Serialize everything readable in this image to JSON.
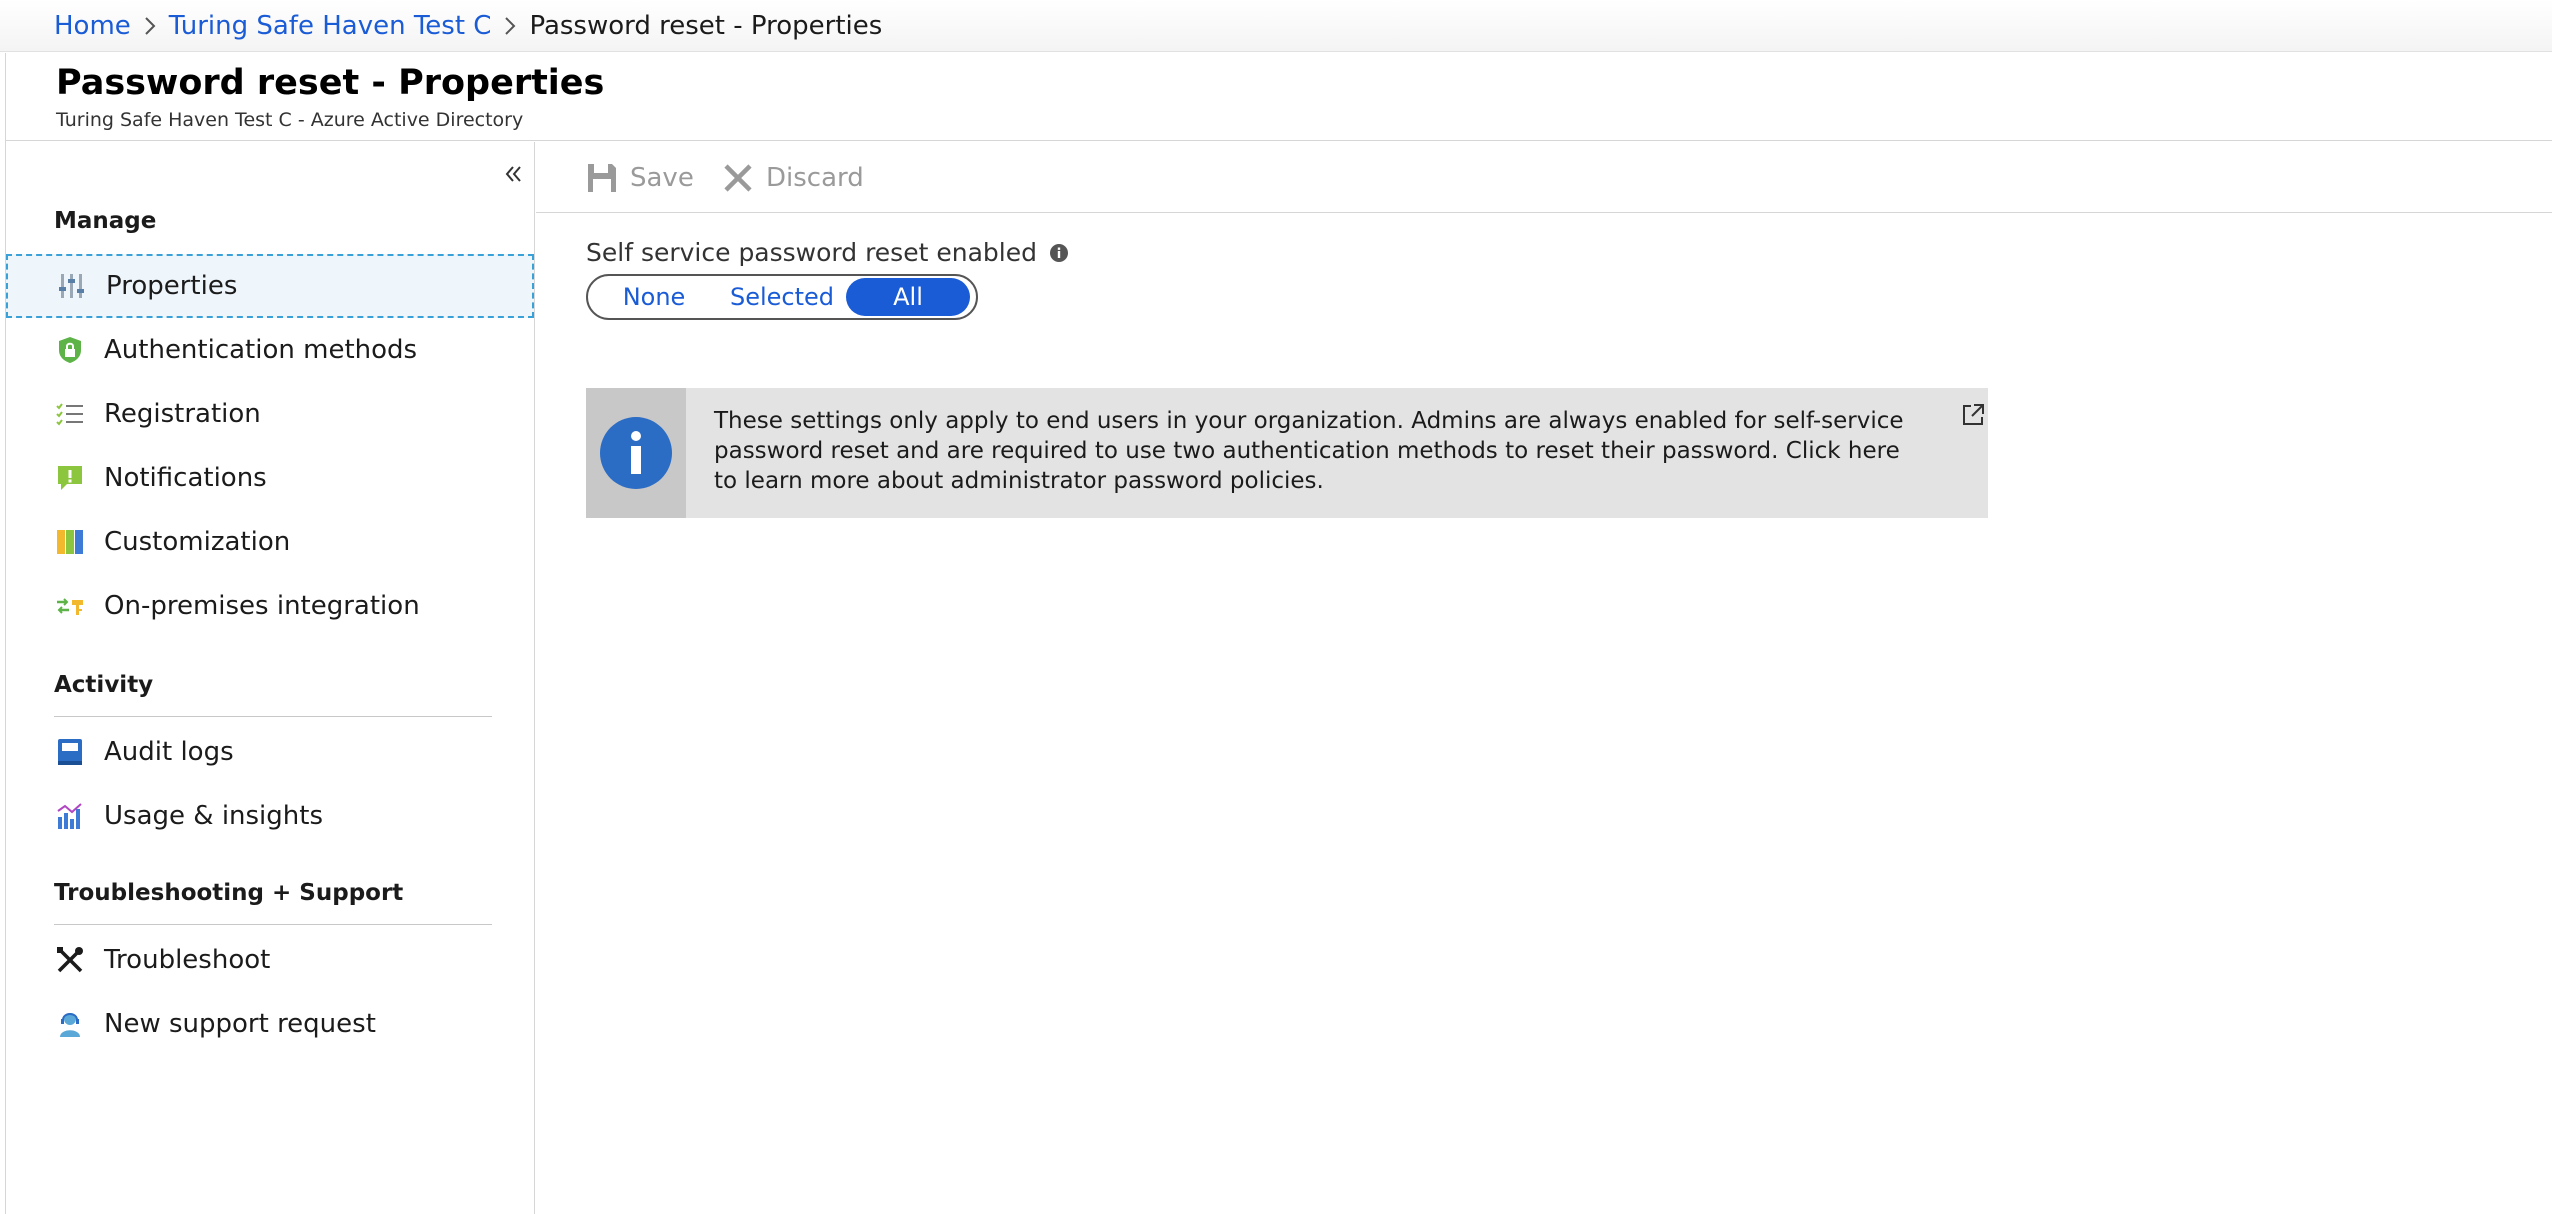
{
  "breadcrumb": {
    "items": [
      {
        "label": "Home",
        "link": true
      },
      {
        "label": "Turing Safe Haven Test C",
        "link": true
      },
      {
        "label": "Password reset - Properties",
        "link": false
      }
    ]
  },
  "header": {
    "title": "Password reset - Properties",
    "subtitle": "Turing Safe Haven Test C - Azure Active Directory"
  },
  "sidebar": {
    "sections": [
      {
        "title": "Manage"
      },
      {
        "title": "Activity"
      },
      {
        "title": "Troubleshooting + Support"
      }
    ],
    "items": [
      {
        "label": "Properties",
        "icon": "properties-icon",
        "selected": true
      },
      {
        "label": "Authentication methods",
        "icon": "shield-lock-icon"
      },
      {
        "label": "Registration",
        "icon": "checklist-icon"
      },
      {
        "label": "Notifications",
        "icon": "notification-icon"
      },
      {
        "label": "Customization",
        "icon": "customization-icon"
      },
      {
        "label": "On-premises integration",
        "icon": "sync-key-icon"
      },
      {
        "label": "Audit logs",
        "icon": "book-icon"
      },
      {
        "label": "Usage & insights",
        "icon": "bar-chart-icon"
      },
      {
        "label": "Troubleshoot",
        "icon": "tools-icon"
      },
      {
        "label": "New support request",
        "icon": "support-person-icon"
      }
    ]
  },
  "toolbar": {
    "save_label": "Save",
    "discard_label": "Discard"
  },
  "sspr": {
    "label": "Self service password reset enabled",
    "options": [
      "None",
      "Selected",
      "All"
    ],
    "selected": "All"
  },
  "banner": {
    "text": "These settings only apply to end users in your organization. Admins are always enabled for self-service password reset and are required to use two authentication methods to reset their password. Click here to learn more about administrator password policies."
  },
  "colors": {
    "accent": "#1a5bd6",
    "banner_bg": "#e3e3e3",
    "selected_border": "#3aa0d8"
  }
}
